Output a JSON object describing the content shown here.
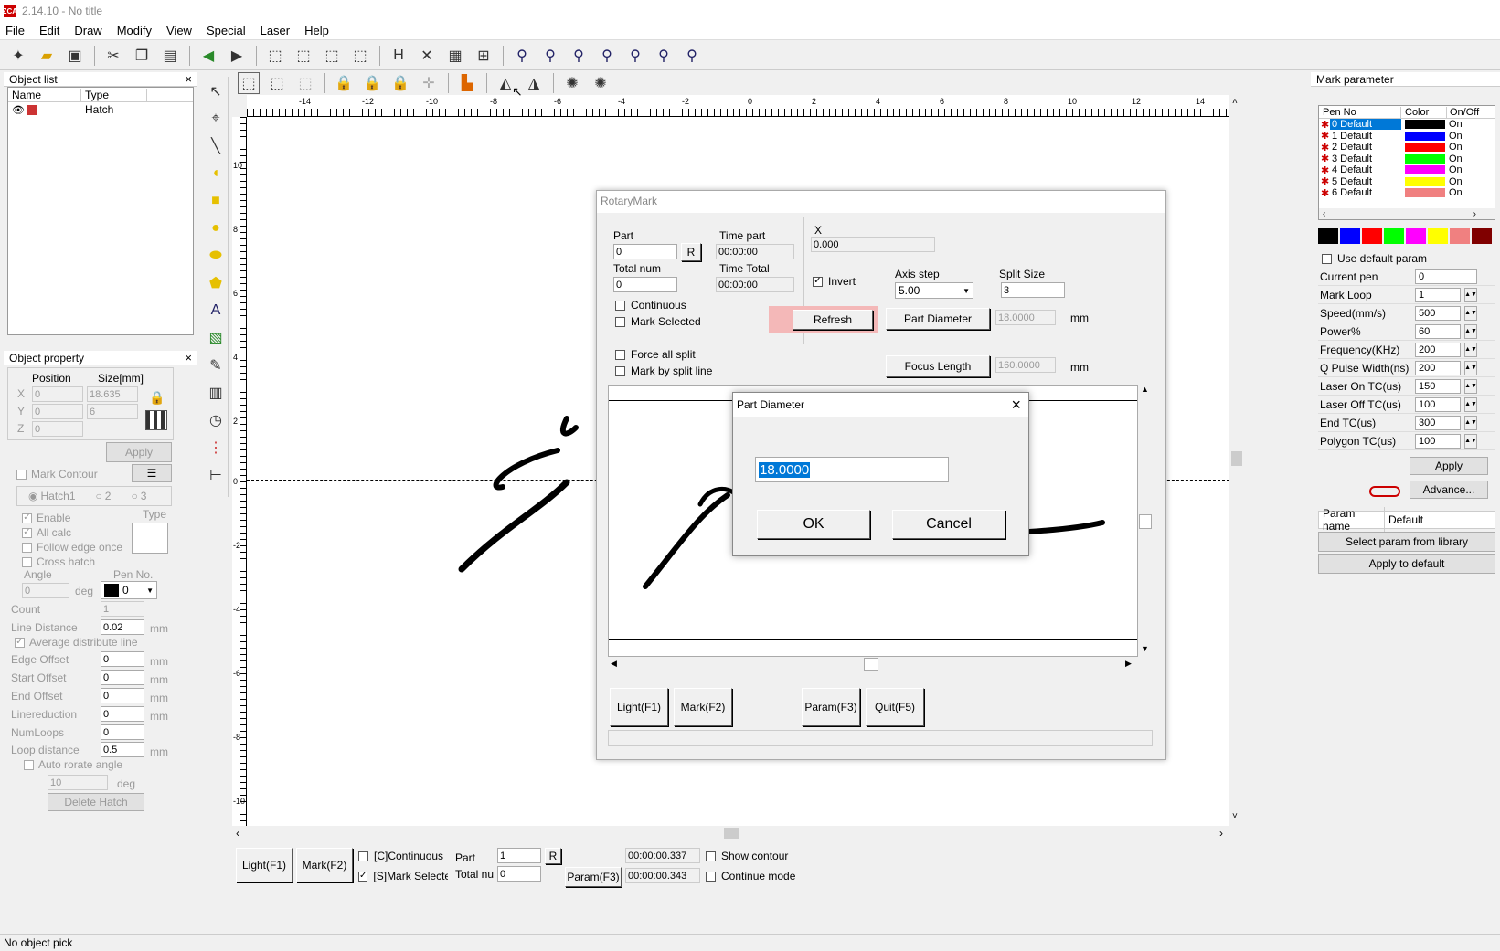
{
  "app": {
    "title": "2.14.10 - No title",
    "logo": "EZCAD"
  },
  "menu": [
    "File",
    "Edit",
    "Draw",
    "Modify",
    "View",
    "Special",
    "Laser",
    "Help"
  ],
  "object_list": {
    "header": "Object list",
    "columns": [
      "Name",
      "Type"
    ],
    "rows": [
      {
        "type": "Hatch"
      }
    ]
  },
  "object_property": {
    "header": "Object property",
    "position_label": "Position",
    "size_label": "Size[mm]",
    "x_label": "X",
    "y_label": "Y",
    "z_label": "Z",
    "x_pos": "0",
    "y_pos": "0",
    "z_pos": "0",
    "x_size": "18.635",
    "y_size": "6",
    "apply": "Apply",
    "mark_contour": "Mark Contour",
    "hatch1": "Hatch1",
    "hatch2": "2",
    "hatch3": "3",
    "type_label": "Type",
    "enable": "Enable",
    "all_calc": "All calc",
    "follow_edge": "Follow edge once",
    "cross_hatch": "Cross hatch",
    "angle_label": "Angle",
    "angle": "0",
    "deg": "deg",
    "pen_no_label": "Pen No.",
    "pen_no": "0",
    "count_label": "Count",
    "count": "1",
    "line_distance_label": "Line Distance",
    "line_distance": "0.02",
    "mm": "mm",
    "avg_distribute": "Average distribute line",
    "edge_offset_label": "Edge Offset",
    "edge_offset": "0",
    "start_offset_label": "Start Offset",
    "start_offset": "0",
    "end_offset_label": "End Offset",
    "end_offset": "0",
    "linereduction_label": "Linereduction",
    "linereduction": "0",
    "numloops_label": "NumLoops",
    "numloops": "0",
    "loop_distance_label": "Loop distance",
    "loop_distance": "0.5",
    "auto_rotate": "Auto rorate angle",
    "auto_rotate_value": "10",
    "delete_hatch": "Delete Hatch"
  },
  "ruler": {
    "h_ticks": [
      "-14",
      "-12",
      "-10",
      "-8",
      "-6",
      "-4",
      "-2",
      "0",
      "2",
      "4",
      "6",
      "8",
      "10",
      "12",
      "14"
    ],
    "v_ticks": [
      "10",
      "8",
      "6",
      "4",
      "2",
      "0",
      "-2",
      "-4",
      "-6",
      "-8",
      "-10"
    ]
  },
  "bottom_bar": {
    "light": "Light(F1)",
    "mark": "Mark(F2)",
    "continuous": "[C]Continuous",
    "mark_selected": "[S]Mark Selected",
    "part_label": "Part",
    "part": "1",
    "r": "R",
    "total_label": "Total num",
    "total": "0",
    "time1": "00:00:00.337",
    "time2": "00:00:00.343",
    "param": "Param(F3)",
    "show_contour": "Show contour",
    "continue_mode": "Continue mode"
  },
  "status": "No object pick",
  "mark_param": {
    "header": "Mark parameter",
    "columns": [
      "Pen No",
      "Color",
      "On/Off"
    ],
    "pens": [
      {
        "name": "0 Default",
        "color": "#000000",
        "state": "On"
      },
      {
        "name": "1 Default",
        "color": "#0000ff",
        "state": "On"
      },
      {
        "name": "2 Default",
        "color": "#ff0000",
        "state": "On"
      },
      {
        "name": "3 Default",
        "color": "#00ff00",
        "state": "On"
      },
      {
        "name": "4 Default",
        "color": "#ff00ff",
        "state": "On"
      },
      {
        "name": "5 Default",
        "color": "#ffff00",
        "state": "On"
      },
      {
        "name": "6 Default",
        "color": "#f08080",
        "state": "On"
      }
    ],
    "swatches": [
      "#000000",
      "#0000ff",
      "#ff0000",
      "#00ff00",
      "#ff00ff",
      "#ffff00",
      "#f08080",
      "#800000"
    ],
    "use_default": "Use default param",
    "params": [
      {
        "k": "Current pen",
        "v": "0"
      },
      {
        "k": "Mark Loop",
        "v": "1"
      },
      {
        "k": "Speed(mm/s)",
        "v": "500"
      },
      {
        "k": "Power%",
        "v": "60"
      },
      {
        "k": "Frequency(KHz)",
        "v": "200"
      },
      {
        "k": "Q Pulse Width(ns)",
        "v": "200"
      },
      {
        "k": "Laser On TC(us)",
        "v": "150"
      },
      {
        "k": "Laser Off TC(us)",
        "v": "100"
      },
      {
        "k": "End TC(us)",
        "v": "300"
      },
      {
        "k": "Polygon TC(us)",
        "v": "100"
      }
    ],
    "apply": "Apply",
    "advance": "Advance...",
    "param_name_label": "Param name",
    "param_name": "Default",
    "select_lib": "Select param from library",
    "apply_default": "Apply to default"
  },
  "rotary": {
    "title": "RotaryMark",
    "part_label": "Part",
    "part": "0",
    "r": "R",
    "time_part_label": "Time part",
    "time_part": "00:00:00",
    "total_num_label": "Total num",
    "total_num": "0",
    "time_total_label": "Time Total",
    "time_total": "00:00:00",
    "x_label": "X",
    "x": "0.000",
    "invert": "Invert",
    "axis_step_label": "Axis step",
    "axis_step": "5.00",
    "split_size_label": "Split Size",
    "split_size": "3",
    "continuous": "Continuous",
    "mark_selected": "Mark Selected",
    "refresh": "Refresh",
    "part_diameter_btn": "Part Diameter",
    "part_diameter": "18.0000",
    "mm": "mm",
    "force_split": "Force all split",
    "mark_split_line": "Mark by split line",
    "focus_length_btn": "Focus Length",
    "focus_length": "160.0000",
    "light": "Light(F1)",
    "mark": "Mark(F2)",
    "param": "Param(F3)",
    "quit": "Quit(F5)"
  },
  "dialog": {
    "title": "Part Diameter",
    "value": "18.0000",
    "ok": "OK",
    "cancel": "Cancel"
  }
}
